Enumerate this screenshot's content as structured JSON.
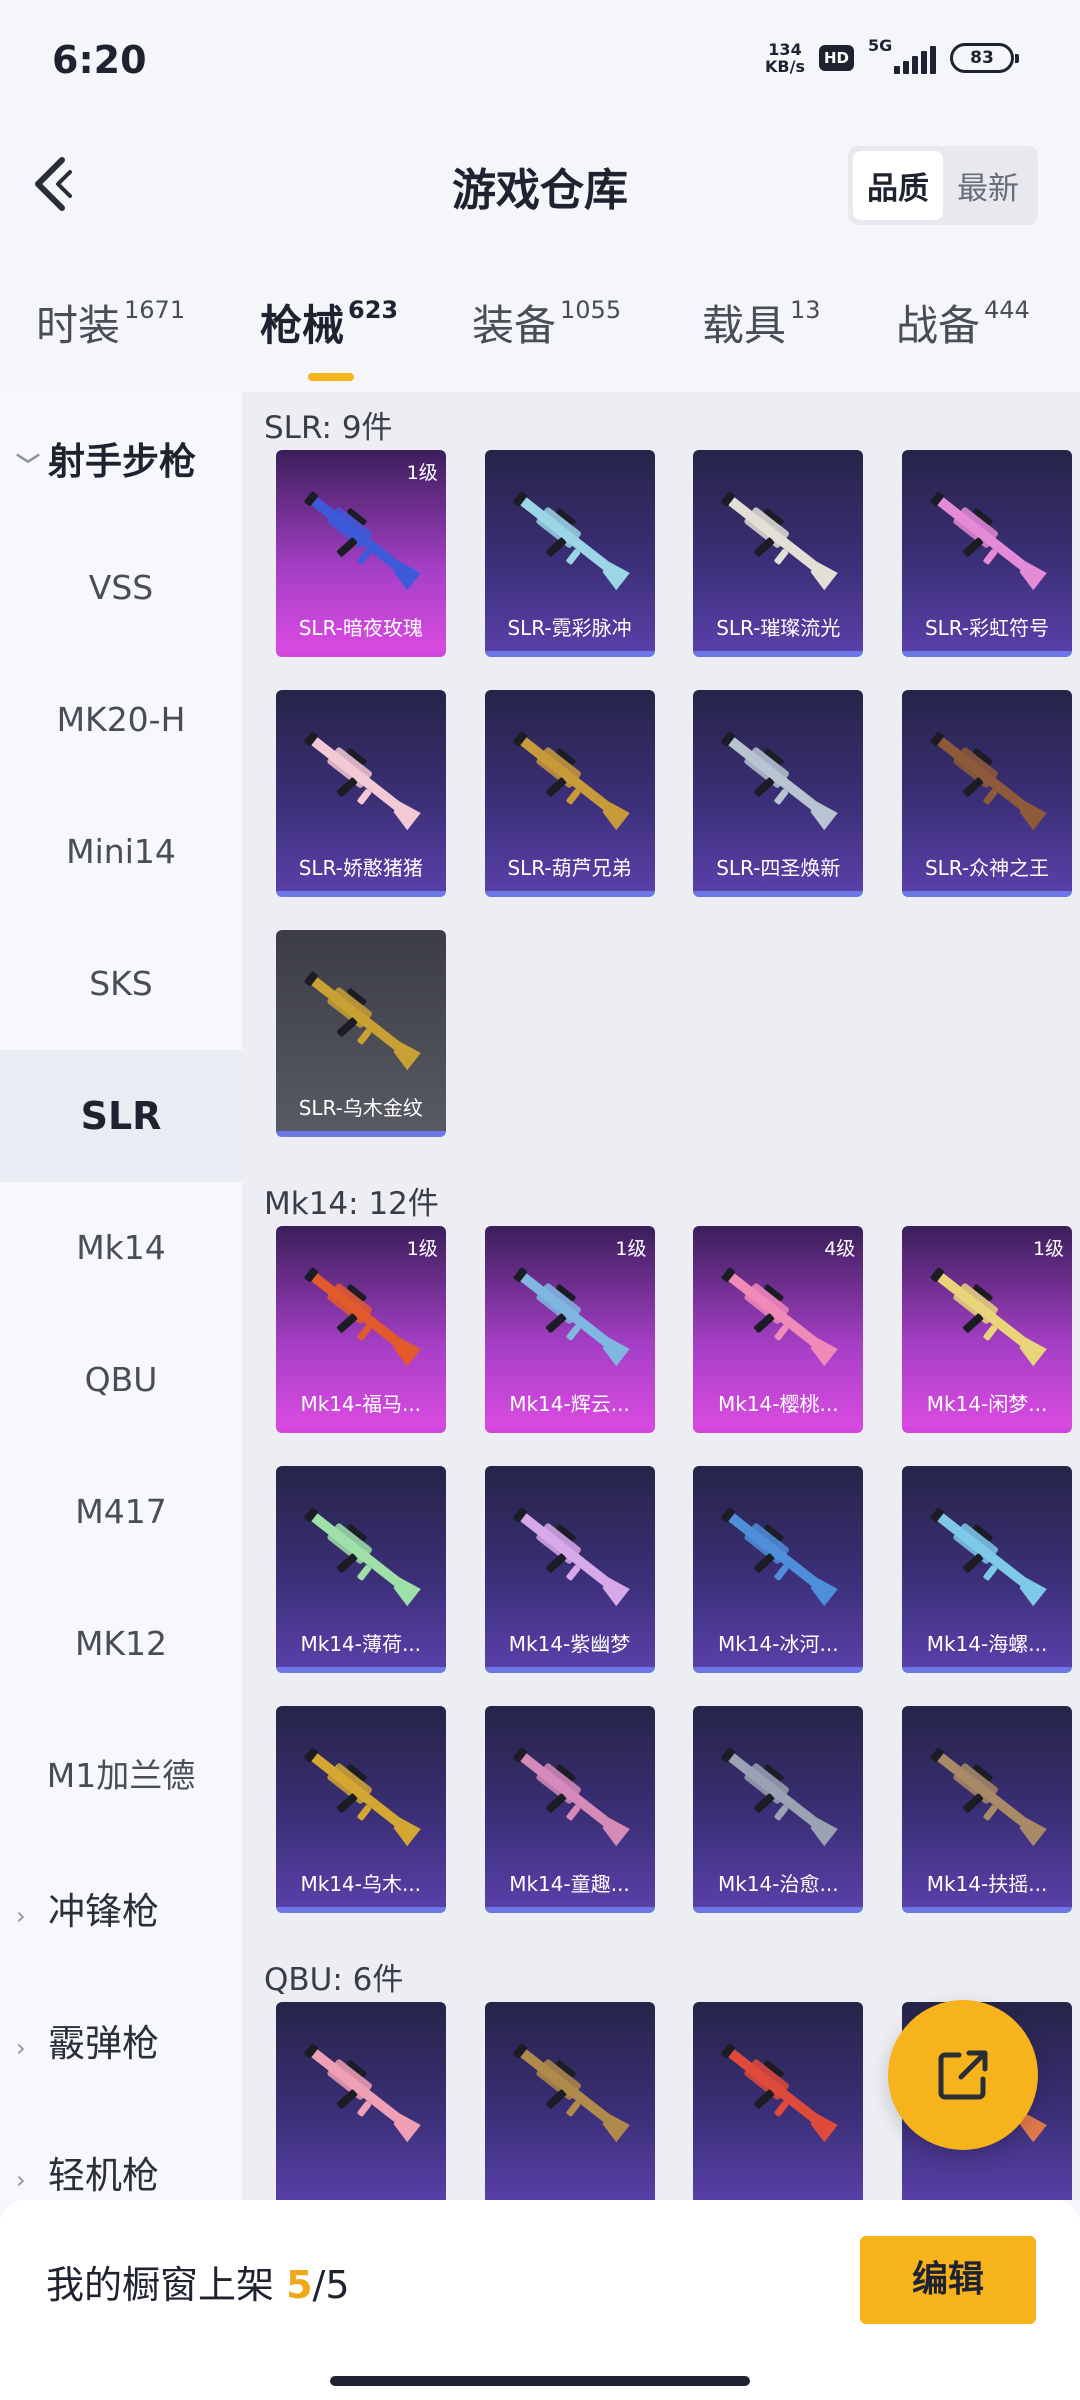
{
  "status_bar": {
    "time": "6:20",
    "speed_value": "134",
    "speed_unit": "KB/s",
    "hd": "HD",
    "network": "5G",
    "battery": "83"
  },
  "header": {
    "title": "游戏仓库",
    "back_icon": "chevron-left-icon",
    "sort_options": [
      "品质",
      "最新"
    ],
    "sort_selected": "品质"
  },
  "tabs": [
    {
      "label": "时装",
      "count": "1671"
    },
    {
      "label": "枪械",
      "count": "623"
    },
    {
      "label": "装备",
      "count": "1055"
    },
    {
      "label": "载具",
      "count": "13"
    },
    {
      "label": "战备",
      "count": "444"
    }
  ],
  "active_tab": "枪械",
  "sidebar": {
    "group_open": "射手步枪",
    "items": [
      "VSS",
      "MK20-H",
      "Mini14",
      "SKS",
      "SLR",
      "Mk14",
      "QBU",
      "M417",
      "MK12",
      "M1加兰德"
    ],
    "active_item": "SLR",
    "collapsed_groups": [
      "冲锋枪",
      "霰弹枪",
      "轻机枪"
    ]
  },
  "sections": [
    {
      "title": "SLR: 9件",
      "cards": [
        {
          "name": "SLR-暗夜玫瑰",
          "level": "1级",
          "rarity": "pink",
          "gun_color": "#3d5bd8"
        },
        {
          "name": "SLR-霓彩脉冲",
          "level": "",
          "rarity": "blue",
          "gun_color": "#9bd6e6"
        },
        {
          "name": "SLR-璀璨流光",
          "level": "",
          "rarity": "blue",
          "gun_color": "#e3dfd6"
        },
        {
          "name": "SLR-彩虹符号",
          "level": "",
          "rarity": "blue",
          "gun_color": "#e58ad6"
        },
        {
          "name": "SLR-娇憨猪猪",
          "level": "",
          "rarity": "blue",
          "gun_color": "#f2c9d4"
        },
        {
          "name": "SLR-葫芦兄弟",
          "level": "",
          "rarity": "blue",
          "gun_color": "#c99a3a"
        },
        {
          "name": "SLR-四圣焕新",
          "level": "",
          "rarity": "blue",
          "gun_color": "#b9c4d2"
        },
        {
          "name": "SLR-众神之王",
          "level": "",
          "rarity": "blue",
          "gun_color": "#8e5a3a"
        },
        {
          "name": "SLR-乌木金纹",
          "level": "",
          "rarity": "gray",
          "gun_color": "#c9a033"
        }
      ]
    },
    {
      "title": "Mk14: 12件",
      "cards": [
        {
          "name": "Mk14-福马...",
          "level": "1级",
          "rarity": "pink",
          "gun_color": "#e2592a"
        },
        {
          "name": "Mk14-辉云...",
          "level": "1级",
          "rarity": "pink",
          "gun_color": "#7fb7e0"
        },
        {
          "name": "Mk14-樱桃...",
          "level": "4级",
          "rarity": "pink",
          "gun_color": "#f08ab8"
        },
        {
          "name": "Mk14-闲梦...",
          "level": "1级",
          "rarity": "pink",
          "gun_color": "#e9d47a"
        },
        {
          "name": "Mk14-薄荷...",
          "level": "",
          "rarity": "blue",
          "gun_color": "#9fe0a8"
        },
        {
          "name": "Mk14-紫幽梦",
          "level": "",
          "rarity": "blue",
          "gun_color": "#d8a9e8"
        },
        {
          "name": "Mk14-冰河...",
          "level": "",
          "rarity": "blue",
          "gun_color": "#4f8ed8"
        },
        {
          "name": "Mk14-海螺...",
          "level": "",
          "rarity": "blue",
          "gun_color": "#7ec8e8"
        },
        {
          "name": "Mk14-乌木...",
          "level": "",
          "rarity": "blue",
          "gun_color": "#d4a632"
        },
        {
          "name": "Mk14-童趣...",
          "level": "",
          "rarity": "blue",
          "gun_color": "#d68ab8"
        },
        {
          "name": "Mk14-治愈...",
          "level": "",
          "rarity": "blue",
          "gun_color": "#9aa2b4"
        },
        {
          "name": "Mk14-扶摇...",
          "level": "",
          "rarity": "blue",
          "gun_color": "#a88a66"
        }
      ]
    },
    {
      "title": "QBU: 6件",
      "cards": [
        {
          "name": "",
          "level": "",
          "rarity": "blue",
          "gun_color": "#f0a0b4"
        },
        {
          "name": "",
          "level": "",
          "rarity": "blue",
          "gun_color": "#b08a4a"
        },
        {
          "name": "",
          "level": "",
          "rarity": "blue",
          "gun_color": "#e04a3a"
        },
        {
          "name": "",
          "level": "",
          "rarity": "blue",
          "gun_color": "#e07a4a"
        }
      ]
    }
  ],
  "fab_icon": "share-icon",
  "bottom_bar": {
    "label": "我的橱窗上架 ",
    "current": "5",
    "separator": "/",
    "total": "5",
    "edit_label": "编辑"
  },
  "colors": {
    "accent": "#f7b31c",
    "pink_rarity": "#d84be0",
    "blue_rarity": "#6b78e5"
  }
}
